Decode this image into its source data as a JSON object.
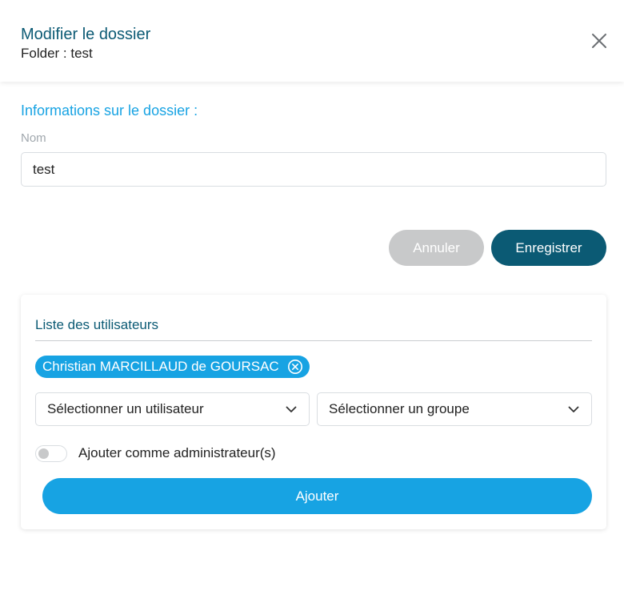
{
  "header": {
    "title": "Modifier le dossier",
    "subtitle": "Folder : test",
    "close_icon": "close-icon"
  },
  "folder_info": {
    "section_title": "Informations sur le dossier :",
    "name_label": "Nom",
    "name_value": "test"
  },
  "actions": {
    "cancel_label": "Annuler",
    "save_label": "Enregistrer"
  },
  "users": {
    "title": "Liste des utilisateurs",
    "selected_users": [
      "Christian MARCILLAUD de GOURSAC"
    ],
    "user_select_placeholder": "Sélectionner un utilisateur",
    "group_select_placeholder": "Sélectionner un groupe",
    "admin_toggle_label": "Ajouter comme administrateur(s)",
    "admin_toggle_on": false,
    "add_label": "Ajouter"
  },
  "colors": {
    "primary_dark": "#0b5a74",
    "accent": "#17a3e3",
    "disabled": "#c8c9ca"
  }
}
